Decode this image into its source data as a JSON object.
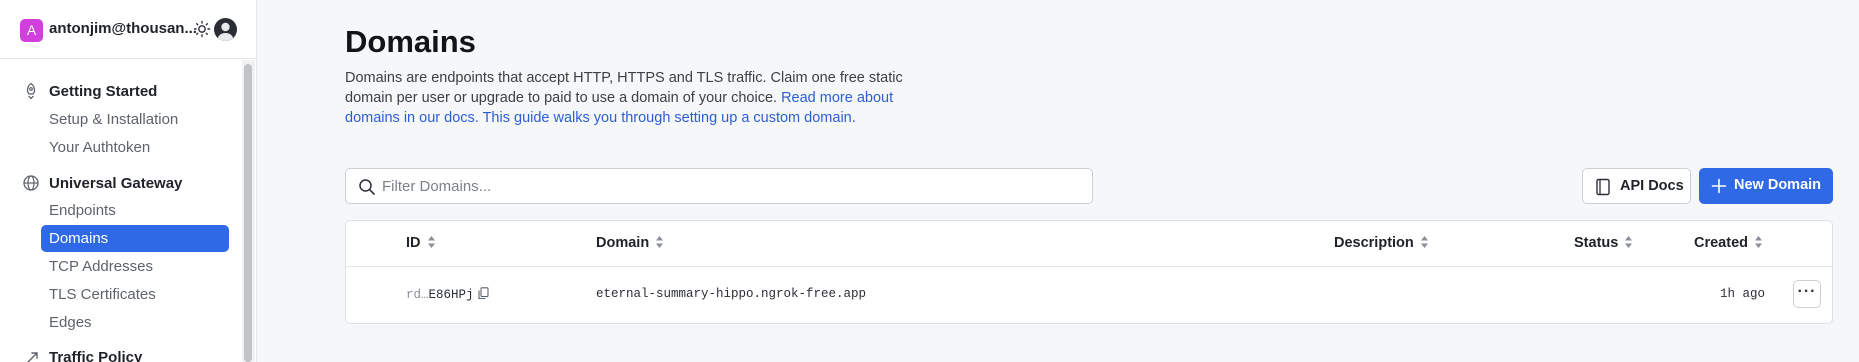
{
  "user": {
    "avatar_letter": "A",
    "email": "antonjim@thousan...",
    "avatar_color": "#d13fdc"
  },
  "sidebar": {
    "sections": [
      {
        "title": "Getting Started",
        "icon": "rocket-icon",
        "items": [
          "Setup & Installation",
          "Your Authtoken"
        ]
      },
      {
        "title": "Universal Gateway",
        "icon": "globe-icon",
        "items": [
          "Endpoints",
          "Domains",
          "TCP Addresses",
          "TLS Certificates",
          "Edges"
        ]
      },
      {
        "title": "Traffic Policy",
        "icon": "traffic-policy-icon",
        "items": []
      }
    ],
    "active_item": "Domains"
  },
  "page": {
    "title": "Domains",
    "description": "Domains are endpoints that accept HTTP, HTTPS and TLS traffic. Claim one free static domain per user or upgrade to paid to use a domain of your choice.",
    "link_text_1": "Read more about domains in our docs.",
    "link_text_2": "This guide walks you through setting up a custom domain."
  },
  "filter": {
    "placeholder": "Filter Domains..."
  },
  "buttons": {
    "api_docs": "API Docs",
    "new_domain": "New Domain"
  },
  "table": {
    "columns": [
      "ID",
      "Domain",
      "Description",
      "Status",
      "Created"
    ],
    "rows": [
      {
        "id_prefix": "rd…",
        "id_suffix": "E86HPj",
        "domain": "eternal-summary-hippo.ngrok-free.app",
        "description": "",
        "status": "",
        "created": "1h ago"
      }
    ]
  },
  "colors": {
    "accent": "#3069e5",
    "link": "#2b5ed8"
  }
}
